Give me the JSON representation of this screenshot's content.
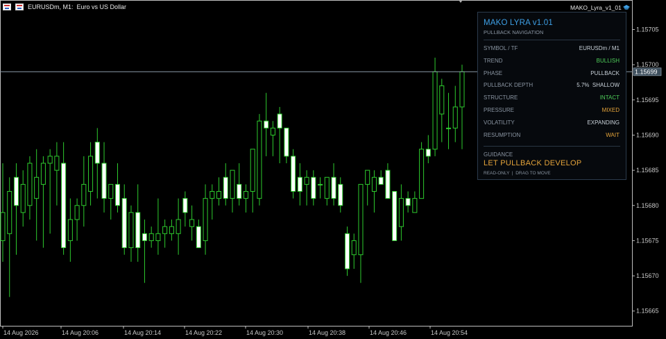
{
  "window": {
    "symbol_title": "EURUSDm, M1:  Euro vs US Dollar",
    "indicator_name": "MAKO_Lyra_v1_01"
  },
  "price_axis": {
    "labels": [
      "1.15705",
      "1.15700",
      "1.15695",
      "1.15690",
      "1.15685",
      "1.15680",
      "1.15675",
      "1.15670",
      "1.15665"
    ],
    "current_price": "1.15699"
  },
  "time_axis": {
    "labels": [
      "14 Aug 2026",
      "14 Aug 20:06",
      "14 Aug 20:14",
      "14 Aug 20:22",
      "14 Aug 20:30",
      "14 Aug 20:38",
      "14 Aug 20:46",
      "14 Aug 20:54"
    ]
  },
  "panel": {
    "title": "MAKO LYRA v1.01",
    "subtitle": "PULLBACK NAVIGATION",
    "rows": [
      {
        "label": "SYMBOL / TF",
        "value": "EURUSDm / M1",
        "color": "#c9d2da"
      },
      {
        "label": "TREND",
        "value": "BULLISH",
        "color": "#4fcf5a"
      },
      {
        "label": "PHASE",
        "value": "PULLBACK",
        "color": "#c9d2da"
      },
      {
        "label": "PULLBACK DEPTH",
        "value": "5.7%  SHALLOW",
        "color": "#c9d2da"
      },
      {
        "label": "STRUCTURE",
        "value": "INTACT",
        "color": "#4fcf5a"
      },
      {
        "label": "PRESSURE",
        "value": "MIXED",
        "color": "#e5a43a"
      },
      {
        "label": "VOLATILITY",
        "value": "EXPANDING",
        "color": "#c9d2da"
      },
      {
        "label": "RESUMPTION",
        "value": "WAIT",
        "color": "#e5a43a"
      }
    ],
    "guidance_label": "GUIDANCE",
    "guidance": "LET PULLBACK DEVELOP",
    "footer": "READ-ONLY  |  DRAG TO MOVE"
  },
  "colors": {
    "background": "#000000",
    "bull_candle_fill": "#000000",
    "bear_candle_fill": "#ffffff",
    "candle_wick": "#2ecc2e",
    "price_line": "#8a9aa8",
    "accent": "#3ea0e6"
  },
  "chart_data": {
    "type": "candlestick",
    "y_range": [
      1.15663,
      1.15709
    ],
    "candles": [
      {
        "o": 1.15675,
        "h": 1.15686,
        "l": 1.15672,
        "c": 1.15679
      },
      {
        "o": 1.15676,
        "h": 1.15684,
        "l": 1.15667,
        "c": 1.15682
      },
      {
        "o": 1.15684,
        "h": 1.15686,
        "l": 1.15673,
        "c": 1.1568
      },
      {
        "o": 1.15679,
        "h": 1.15685,
        "l": 1.15677,
        "c": 1.15683
      },
      {
        "o": 1.1568,
        "h": 1.15687,
        "l": 1.15678,
        "c": 1.15686
      },
      {
        "o": 1.15681,
        "h": 1.15688,
        "l": 1.15675,
        "c": 1.15684
      },
      {
        "o": 1.15683,
        "h": 1.15687,
        "l": 1.15674,
        "c": 1.15686
      },
      {
        "o": 1.15686,
        "h": 1.15688,
        "l": 1.15676,
        "c": 1.15687
      },
      {
        "o": 1.15685,
        "h": 1.15689,
        "l": 1.1568,
        "c": 1.15687
      },
      {
        "o": 1.15686,
        "h": 1.15689,
        "l": 1.15673,
        "c": 1.15674
      },
      {
        "o": 1.15675,
        "h": 1.15681,
        "l": 1.15672,
        "c": 1.15678
      },
      {
        "o": 1.15678,
        "h": 1.15681,
        "l": 1.15675,
        "c": 1.1568
      },
      {
        "o": 1.1568,
        "h": 1.15687,
        "l": 1.15677,
        "c": 1.15683
      },
      {
        "o": 1.15682,
        "h": 1.15689,
        "l": 1.1568,
        "c": 1.15687
      },
      {
        "o": 1.15689,
        "h": 1.15691,
        "l": 1.15681,
        "c": 1.15686
      },
      {
        "o": 1.15686,
        "h": 1.15689,
        "l": 1.15679,
        "c": 1.15681
      },
      {
        "o": 1.15681,
        "h": 1.15683,
        "l": 1.15678,
        "c": 1.15683
      },
      {
        "o": 1.15683,
        "h": 1.15686,
        "l": 1.15679,
        "c": 1.1568
      },
      {
        "o": 1.15681,
        "h": 1.15683,
        "l": 1.15673,
        "c": 1.15674
      },
      {
        "o": 1.15674,
        "h": 1.1568,
        "l": 1.15672,
        "c": 1.15679
      },
      {
        "o": 1.15679,
        "h": 1.15683,
        "l": 1.15672,
        "c": 1.15674
      },
      {
        "o": 1.15676,
        "h": 1.15678,
        "l": 1.15669,
        "c": 1.15675
      },
      {
        "o": 1.15675,
        "h": 1.15677,
        "l": 1.15674,
        "c": 1.15676
      },
      {
        "o": 1.15675,
        "h": 1.15681,
        "l": 1.15673,
        "c": 1.15676
      },
      {
        "o": 1.15676,
        "h": 1.15678,
        "l": 1.15674,
        "c": 1.15677
      },
      {
        "o": 1.15676,
        "h": 1.15678,
        "l": 1.15675,
        "c": 1.15677
      },
      {
        "o": 1.15676,
        "h": 1.15681,
        "l": 1.15673,
        "c": 1.15678
      },
      {
        "o": 1.15681,
        "h": 1.15682,
        "l": 1.15677,
        "c": 1.15679
      },
      {
        "o": 1.15677,
        "h": 1.1568,
        "l": 1.15675,
        "c": 1.15678
      },
      {
        "o": 1.15677,
        "h": 1.15678,
        "l": 1.15674,
        "c": 1.15674
      },
      {
        "o": 1.15675,
        "h": 1.15683,
        "l": 1.15673,
        "c": 1.15681
      },
      {
        "o": 1.15681,
        "h": 1.15683,
        "l": 1.15678,
        "c": 1.15682
      },
      {
        "o": 1.15681,
        "h": 1.15684,
        "l": 1.1568,
        "c": 1.15682
      },
      {
        "o": 1.15684,
        "h": 1.15686,
        "l": 1.1568,
        "c": 1.15681
      },
      {
        "o": 1.15681,
        "h": 1.15685,
        "l": 1.15679,
        "c": 1.15685
      },
      {
        "o": 1.15683,
        "h": 1.15686,
        "l": 1.1568,
        "c": 1.15681
      },
      {
        "o": 1.15681,
        "h": 1.15683,
        "l": 1.15679,
        "c": 1.15682
      },
      {
        "o": 1.15682,
        "h": 1.15688,
        "l": 1.15679,
        "c": 1.15688
      },
      {
        "o": 1.15681,
        "h": 1.15693,
        "l": 1.1568,
        "c": 1.15692
      },
      {
        "o": 1.15692,
        "h": 1.15696,
        "l": 1.15687,
        "c": 1.15691
      },
      {
        "o": 1.1569,
        "h": 1.15692,
        "l": 1.15687,
        "c": 1.15691
      },
      {
        "o": 1.15693,
        "h": 1.15694,
        "l": 1.15686,
        "c": 1.15691
      },
      {
        "o": 1.15691,
        "h": 1.15691,
        "l": 1.15686,
        "c": 1.15687
      },
      {
        "o": 1.15687,
        "h": 1.15688,
        "l": 1.15681,
        "c": 1.15682
      },
      {
        "o": 1.15684,
        "h": 1.15686,
        "l": 1.1568,
        "c": 1.15682
      },
      {
        "o": 1.15683,
        "h": 1.15685,
        "l": 1.1568,
        "c": 1.15684
      },
      {
        "o": 1.15684,
        "h": 1.15685,
        "l": 1.1568,
        "c": 1.15681
      },
      {
        "o": 1.15683,
        "h": 1.15684,
        "l": 1.15681,
        "c": 1.15683
      },
      {
        "o": 1.15681,
        "h": 1.15684,
        "l": 1.1568,
        "c": 1.15684
      },
      {
        "o": 1.15684,
        "h": 1.15686,
        "l": 1.1568,
        "c": 1.15681
      },
      {
        "o": 1.15683,
        "h": 1.15684,
        "l": 1.15679,
        "c": 1.1568
      },
      {
        "o": 1.15676,
        "h": 1.15677,
        "l": 1.1567,
        "c": 1.15671
      },
      {
        "o": 1.15673,
        "h": 1.15676,
        "l": 1.15671,
        "c": 1.15675
      },
      {
        "o": 1.15673,
        "h": 1.15683,
        "l": 1.15669,
        "c": 1.15683
      },
      {
        "o": 1.15683,
        "h": 1.15685,
        "l": 1.1568,
        "c": 1.15685
      },
      {
        "o": 1.15682,
        "h": 1.15685,
        "l": 1.15679,
        "c": 1.15684
      },
      {
        "o": 1.15684,
        "h": 1.15685,
        "l": 1.15683,
        "c": 1.15683
      },
      {
        "o": 1.15685,
        "h": 1.15686,
        "l": 1.15681,
        "c": 1.15681
      },
      {
        "o": 1.15682,
        "h": 1.15682,
        "l": 1.15675,
        "c": 1.15675
      },
      {
        "o": 1.15677,
        "h": 1.15683,
        "l": 1.15675,
        "c": 1.15681
      },
      {
        "o": 1.15681,
        "h": 1.15682,
        "l": 1.15679,
        "c": 1.1568
      },
      {
        "o": 1.15679,
        "h": 1.15682,
        "l": 1.15679,
        "c": 1.15681
      },
      {
        "o": 1.15681,
        "h": 1.15689,
        "l": 1.15681,
        "c": 1.15688
      },
      {
        "o": 1.15688,
        "h": 1.1569,
        "l": 1.15686,
        "c": 1.15687
      },
      {
        "o": 1.15688,
        "h": 1.15701,
        "l": 1.15687,
        "c": 1.15699
      },
      {
        "o": 1.15693,
        "h": 1.15698,
        "l": 1.15689,
        "c": 1.15697
      },
      {
        "o": 1.15691,
        "h": 1.15696,
        "l": 1.15688,
        "c": 1.15691
      },
      {
        "o": 1.15691,
        "h": 1.15697,
        "l": 1.15689,
        "c": 1.15694
      },
      {
        "o": 1.15694,
        "h": 1.157,
        "l": 1.15688,
        "c": 1.15699
      }
    ]
  }
}
